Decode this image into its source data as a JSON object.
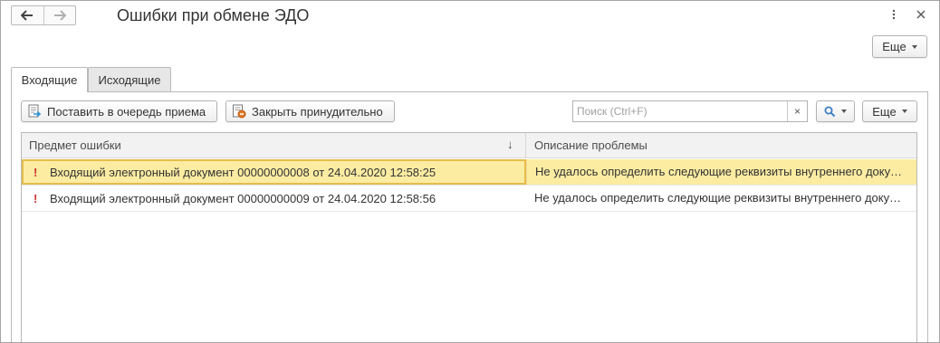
{
  "window": {
    "title": "Ошибки при обмене ЭДО",
    "back_icon": "arrow-left-icon",
    "forward_icon": "arrow-right-icon",
    "menu_icon": "more-vertical-icon",
    "close_icon": "close-icon",
    "more_label": "Еще"
  },
  "tabs": [
    {
      "label": "Входящие",
      "active": true
    },
    {
      "label": "Исходящие",
      "active": false
    }
  ],
  "toolbar": {
    "enqueue_label": "Поставить в очередь приема",
    "force_close_label": "Закрыть принудительно",
    "search_placeholder": "Поиск (Ctrl+F)",
    "search_value": "",
    "clear_glyph": "×",
    "more_label": "Еще"
  },
  "table": {
    "columns": [
      "Предмет ошибки",
      "Описание проблемы"
    ],
    "sort_glyph": "↓",
    "rows": [
      {
        "marker": "!",
        "subject": "Входящий электронный документ 00000000008 от 24.04.2020 12:58:25",
        "description": "Не удалось определить следующие реквизиты внутреннего документа",
        "selected": true
      },
      {
        "marker": "!",
        "subject": "Входящий электронный документ 00000000009 от 24.04.2020 12:58:56",
        "description": "Не удалось определить следующие реквизиты внутреннего документа",
        "selected": false
      }
    ]
  },
  "colors": {
    "selected_row": "#fbeca2",
    "selected_border": "#e5bd4c",
    "error_marker": "#d12f2f",
    "search_accent": "#3d7fc6"
  }
}
